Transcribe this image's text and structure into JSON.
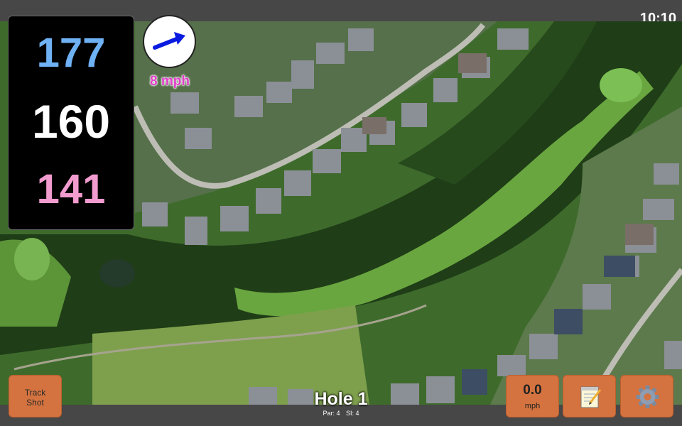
{
  "status": {
    "time": "10:10"
  },
  "yardages": {
    "back": "177",
    "center": "160",
    "front": "141"
  },
  "wind": {
    "speed_label": "8 mph",
    "direction_icon": "wind-arrow-icon"
  },
  "hole": {
    "title": "Hole 1",
    "par": "Par: 4",
    "si": "SI: 4"
  },
  "buttons": {
    "track_line1": "Track",
    "track_line2": "Shot",
    "speed_value": "0.0",
    "speed_unit": "mph",
    "notes_icon": "notepad-icon",
    "settings_icon": "gear-icon"
  },
  "colors": {
    "back_yardage": "#6fb1f5",
    "center_yardage": "#ffffff",
    "front_yardage": "#f29bcf",
    "button": "#d4733f",
    "wind_text": "#e040c8"
  }
}
